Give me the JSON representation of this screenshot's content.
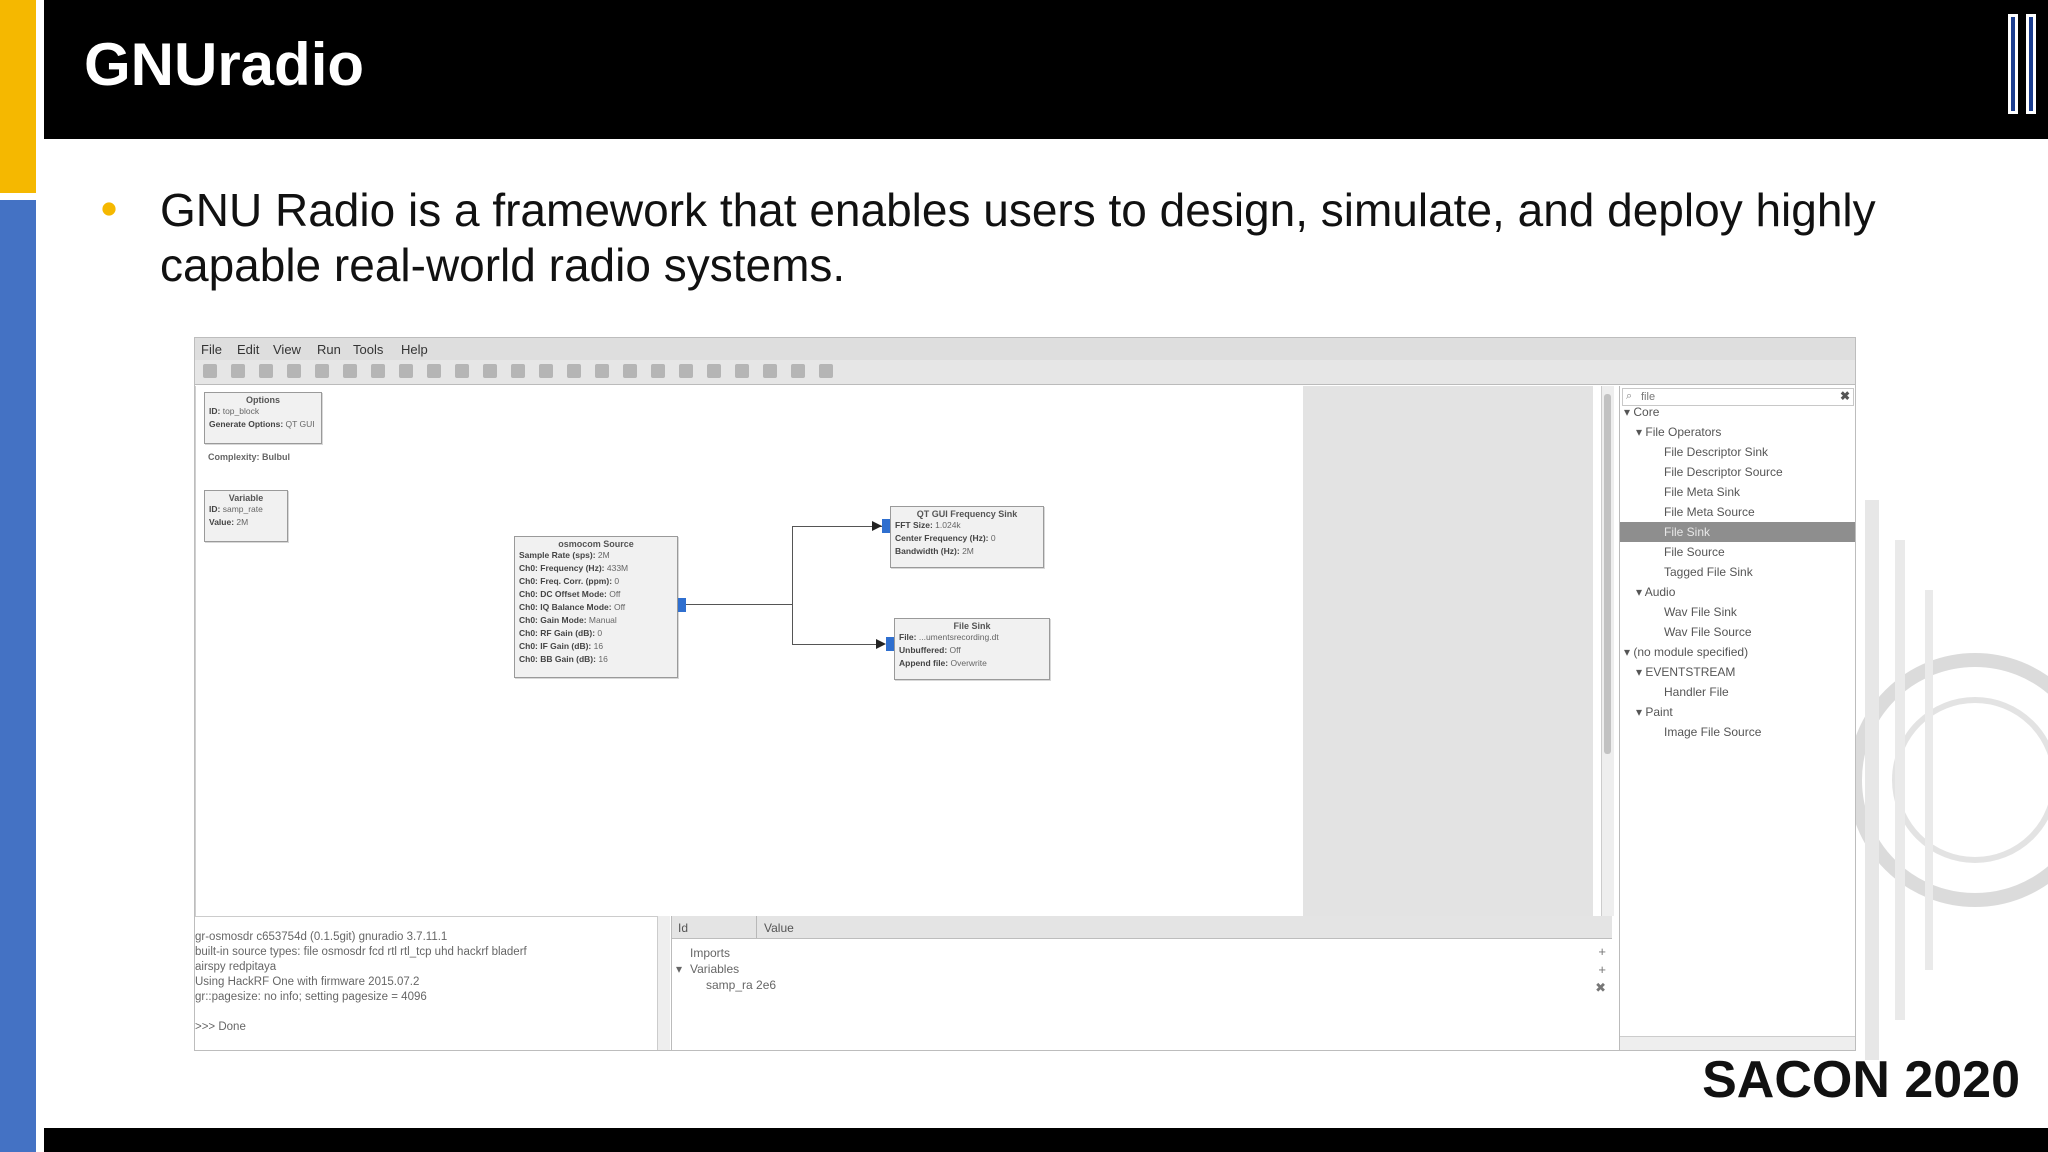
{
  "slide": {
    "title": "GNUradio",
    "bullet": "GNU Radio is a framework that enables users to design, simulate, and deploy highly capable real-world radio systems.",
    "brand": "SACON 2020",
    "colors": {
      "accent_yellow": "#f5b800",
      "accent_blue": "#4472c4",
      "header_bg": "#000000"
    }
  },
  "app": {
    "menu": [
      "File",
      "Edit",
      "View",
      "Run",
      "Tools",
      "Help"
    ],
    "toolbar_icons": [
      "new-icon",
      "open-icon",
      "save-icon",
      "close-icon",
      "screenshot-icon",
      "cut-icon",
      "copy-icon",
      "paste-icon",
      "delete-icon",
      "undo-icon",
      "redo-icon",
      "stop-icon",
      "generate-icon",
      "run-icon",
      "kill-icon",
      "rotate-left-icon",
      "rotate-right-icon",
      "enable-icon",
      "disable-icon",
      "bypass-icon",
      "find-icon",
      "reload-icon",
      "help-icon"
    ],
    "blocks": {
      "options": {
        "title": "Options",
        "lines": [
          [
            "ID:",
            "top_block"
          ],
          [
            "Generate Options:",
            "QT GUI"
          ]
        ]
      },
      "complexity": "Complexity: Bulbul",
      "variable": {
        "title": "Variable",
        "lines": [
          [
            "ID:",
            "samp_rate"
          ],
          [
            "Value:",
            "2M"
          ]
        ]
      },
      "osmocom": {
        "title": "osmocom Source",
        "lines": [
          [
            "Sample Rate (sps):",
            "2M"
          ],
          [
            "Ch0: Frequency (Hz):",
            "433M"
          ],
          [
            "Ch0: Freq. Corr. (ppm):",
            "0"
          ],
          [
            "Ch0: DC Offset Mode:",
            "Off"
          ],
          [
            "Ch0: IQ Balance Mode:",
            "Off"
          ],
          [
            "Ch0: Gain Mode:",
            "Manual"
          ],
          [
            "Ch0: RF Gain (dB):",
            "0"
          ],
          [
            "Ch0: IF Gain (dB):",
            "16"
          ],
          [
            "Ch0: BB Gain (dB):",
            "16"
          ]
        ]
      },
      "freq_sink": {
        "title": "QT GUI Frequency Sink",
        "lines": [
          [
            "FFT Size:",
            "1.024k"
          ],
          [
            "Center Frequency (Hz):",
            "0"
          ],
          [
            "Bandwidth (Hz):",
            "2M"
          ]
        ]
      },
      "file_sink": {
        "title": "File Sink",
        "lines": [
          [
            "File:",
            "...umentsrecording.dt"
          ],
          [
            "Unbuffered:",
            "Off"
          ],
          [
            "Append file:",
            "Overwrite"
          ]
        ]
      }
    },
    "console": [
      "gr-osmosdr c653754d (0.1.5git) gnuradio 3.7.11.1",
      "built-in source types: file osmosdr fcd rtl rtl_tcp uhd hackrf bladerf",
      "airspy redpitaya",
      "Using HackRF One with firmware 2015.07.2",
      "gr::pagesize: no info; setting pagesize = 4096",
      ">>> Done"
    ],
    "vars": {
      "headers": [
        "Id",
        "Value"
      ],
      "rows": [
        "Imports",
        "Variables",
        "samp_ra 2e6"
      ],
      "buttons": [
        "+",
        "+",
        "✖"
      ]
    },
    "library": {
      "search": "file",
      "clear": "✖",
      "items": [
        "Core",
        "File Operators",
        "File Descriptor Sink",
        "File Descriptor Source",
        "File Meta Sink",
        "File Meta Source",
        "File Sink",
        "File Source",
        "Tagged File Sink",
        "Audio",
        "Wav File Sink",
        "Wav File Source",
        "(no module specified)",
        "EVENTSTREAM",
        "Handler File",
        "Paint",
        "Image File Source"
      ]
    }
  }
}
